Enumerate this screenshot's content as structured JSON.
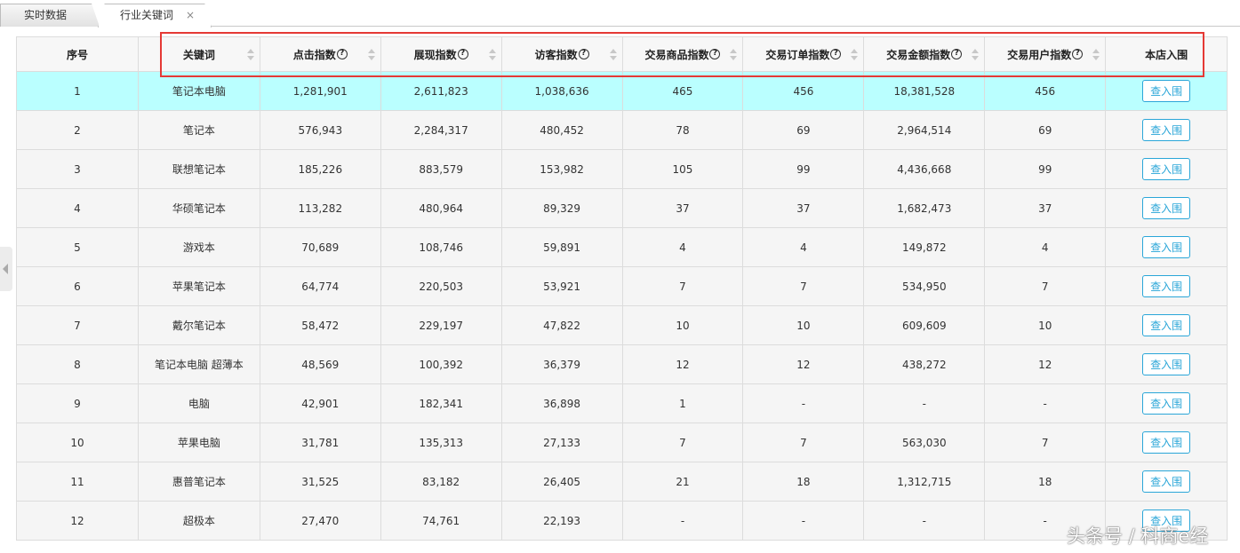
{
  "tabs": [
    {
      "label": "实时数据"
    },
    {
      "label": "行业关键词",
      "close": "×"
    }
  ],
  "table": {
    "headers": [
      "序号",
      "关键词",
      "点击指数",
      "展现指数",
      "访客指数",
      "交易商品指数",
      "交易订单指数",
      "交易金额指数",
      "交易用户指数",
      "本店入围"
    ],
    "help_mark": "?",
    "action_label": "查入围",
    "rows": [
      [
        "1",
        "笔记本电脑",
        "1,281,901",
        "2,611,823",
        "1,038,636",
        "465",
        "456",
        "18,381,528",
        "456"
      ],
      [
        "2",
        "笔记本",
        "576,943",
        "2,284,317",
        "480,452",
        "78",
        "69",
        "2,964,514",
        "69"
      ],
      [
        "3",
        "联想笔记本",
        "185,226",
        "883,579",
        "153,982",
        "105",
        "99",
        "4,436,668",
        "99"
      ],
      [
        "4",
        "华硕笔记本",
        "113,282",
        "480,964",
        "89,329",
        "37",
        "37",
        "1,682,473",
        "37"
      ],
      [
        "5",
        "游戏本",
        "70,689",
        "108,746",
        "59,891",
        "4",
        "4",
        "149,872",
        "4"
      ],
      [
        "6",
        "苹果笔记本",
        "64,774",
        "220,503",
        "53,921",
        "7",
        "7",
        "534,950",
        "7"
      ],
      [
        "7",
        "戴尔笔记本",
        "58,472",
        "229,197",
        "47,822",
        "10",
        "10",
        "609,609",
        "10"
      ],
      [
        "8",
        "笔记本电脑 超薄本",
        "48,569",
        "100,392",
        "36,379",
        "12",
        "12",
        "438,272",
        "12"
      ],
      [
        "9",
        "电脑",
        "42,901",
        "182,341",
        "36,898",
        "1",
        "-",
        "-",
        "-"
      ],
      [
        "10",
        "苹果电脑",
        "31,781",
        "135,313",
        "27,133",
        "7",
        "7",
        "563,030",
        "7"
      ],
      [
        "11",
        "惠普笔记本",
        "31,525",
        "83,182",
        "26,405",
        "21",
        "18",
        "1,312,715",
        "18"
      ],
      [
        "12",
        "超极本",
        "27,470",
        "74,761",
        "22,193",
        "-",
        "-",
        "-",
        "-"
      ]
    ]
  },
  "watermark": "头条号 / 科商e经",
  "colors": {
    "highlight_row": "#baffff",
    "accent": "#2aa6d8",
    "annotation_box": "#e53935"
  }
}
